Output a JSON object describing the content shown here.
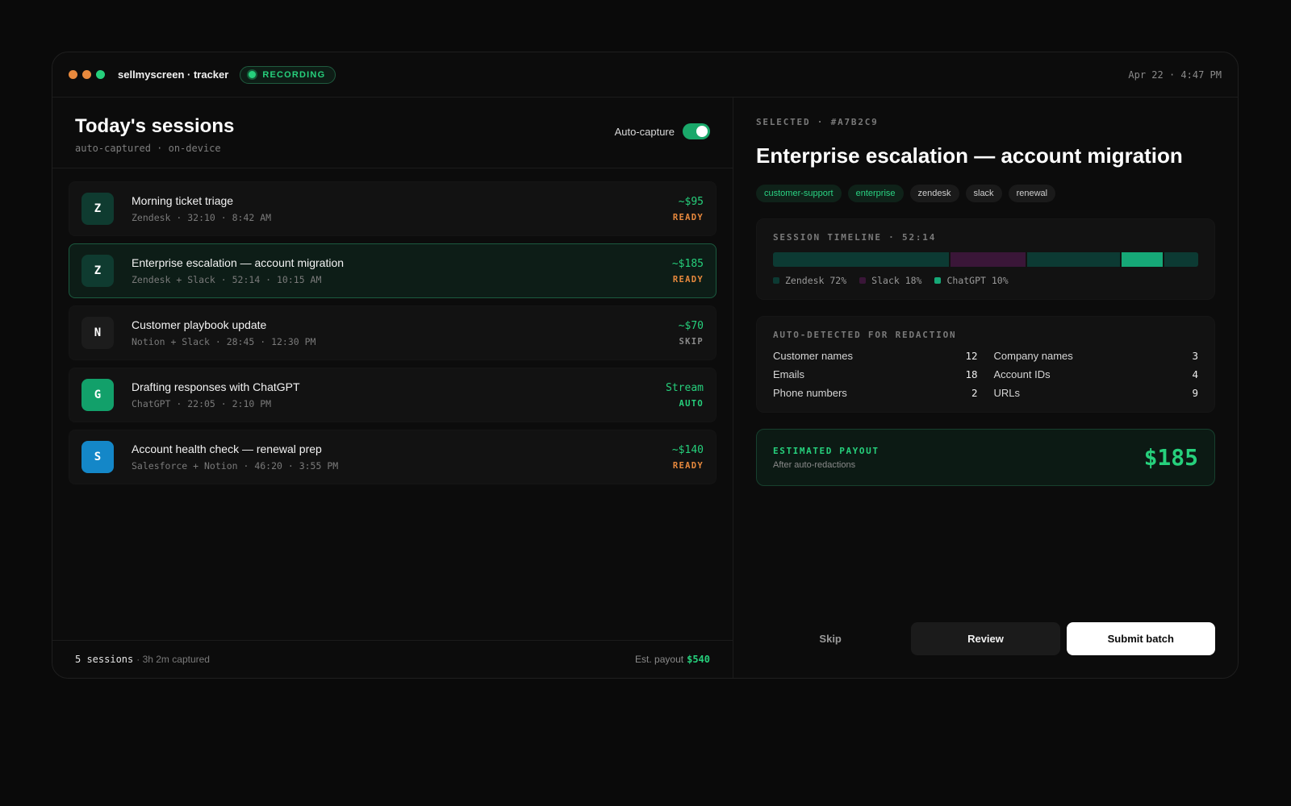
{
  "titlebar": {
    "app_title": "sellmyscreen · tracker",
    "recording_label": "RECORDING",
    "clock": "Apr 22 · 4:47 PM",
    "dot_colors": [
      "#e8893d",
      "#e8893d",
      "#26d07c"
    ]
  },
  "sessions_panel": {
    "title": "Today's sessions",
    "subtitle": "auto-captured · on-device",
    "auto_capture_label": "Auto-capture",
    "auto_capture_on": true,
    "items": [
      {
        "icon_letter": "Z",
        "icon_bg": "#0f3b30",
        "title": "Morning ticket triage",
        "meta": "Zendesk · 32:10 · 8:42 AM",
        "amount": "~$95",
        "status": "READY",
        "status_color": "#e8893d",
        "selected": false
      },
      {
        "icon_letter": "Z",
        "icon_bg": "#0f3b30",
        "title": "Enterprise escalation — account migration",
        "meta": "Zendesk + Slack · 52:14 · 10:15 AM",
        "amount": "~$185",
        "status": "READY",
        "status_color": "#e8893d",
        "selected": true
      },
      {
        "icon_letter": "N",
        "icon_bg": "#1c1c1c",
        "title": "Customer playbook update",
        "meta": "Notion + Slack · 28:45 · 12:30 PM",
        "amount": "~$70",
        "status": "SKIP",
        "status_color": "#8a8a8a",
        "selected": false
      },
      {
        "icon_letter": "G",
        "icon_bg": "#12a06a",
        "title": "Drafting responses with ChatGPT",
        "meta": "ChatGPT · 22:05 · 2:10 PM",
        "amount": "Stream",
        "status": "AUTO",
        "status_color": "#26d07c",
        "selected": false
      },
      {
        "icon_letter": "S",
        "icon_bg": "#1487c8",
        "title": "Account health check — renewal prep",
        "meta": "Salesforce + Notion · 46:20 · 3:55 PM",
        "amount": "~$140",
        "status": "READY",
        "status_color": "#e8893d",
        "selected": false
      }
    ],
    "footer": {
      "count": "5 sessions",
      "captured": "· 3h 2m captured",
      "payout_label": "Est. payout",
      "payout_value": "$540"
    }
  },
  "detail": {
    "selected_label": "SELECTED · #A7B2C9",
    "title": "Enterprise escalation — account migration",
    "tags": [
      {
        "label": "customer-support",
        "accent": true
      },
      {
        "label": "enterprise",
        "accent": true
      },
      {
        "label": "zendesk",
        "accent": false
      },
      {
        "label": "slack",
        "accent": false
      },
      {
        "label": "renewal",
        "accent": false
      }
    ],
    "timeline": {
      "label": "SESSION TIMELINE · 52:14",
      "segments": [
        {
          "app": "Zendesk",
          "fraction": 0.42,
          "color": "#0c3a33"
        },
        {
          "app": "Slack",
          "fraction": 0.18,
          "color": "#3a1638"
        },
        {
          "app": "Zendesk",
          "fraction": 0.22,
          "color": "#0c3a33"
        },
        {
          "app": "ChatGPT",
          "fraction": 0.1,
          "color": "#16a877"
        },
        {
          "app": "Zendesk",
          "fraction": 0.08,
          "color": "#0c3a33"
        }
      ],
      "legend": [
        {
          "label": "Zendesk 72%",
          "color": "#0c3a33"
        },
        {
          "label": "Slack 18%",
          "color": "#3a1638"
        },
        {
          "label": "ChatGPT 10%",
          "color": "#16a877"
        }
      ]
    },
    "redaction": {
      "label": "AUTO-DETECTED FOR REDACTION",
      "rows": [
        {
          "name": "Customer names",
          "value": "12"
        },
        {
          "name": "Company names",
          "value": "3"
        },
        {
          "name": "Emails",
          "value": "18"
        },
        {
          "name": "Account IDs",
          "value": "4"
        },
        {
          "name": "Phone numbers",
          "value": "2"
        },
        {
          "name": "URLs",
          "value": "9"
        }
      ]
    },
    "payout": {
      "label": "ESTIMATED PAYOUT",
      "sub": "After auto-redactions",
      "amount": "$185"
    },
    "actions": {
      "skip": "Skip",
      "review": "Review",
      "submit": "Submit batch"
    }
  }
}
